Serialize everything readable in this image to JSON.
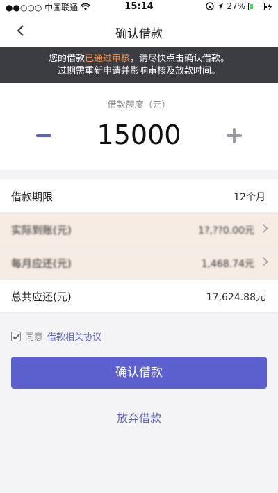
{
  "status_bar": {
    "carrier": "●●○○○ 中国联通",
    "time": "15:14",
    "battery": "27%",
    "battery_level": 0.27
  },
  "nav": {
    "title": "确认借款",
    "back_icon": "chevron-left-icon"
  },
  "notice": {
    "line1_prefix": "您的借款",
    "line1_highlight": "已通过审核",
    "line1_suffix": "，请尽快点击确认借款。",
    "line2": "过期需重新申请并影响审核及放款时间。"
  },
  "amount_card": {
    "label": "借款额度（元）",
    "amount": "15000",
    "minus_icon": "minus-icon",
    "plus_icon": "plus-icon"
  },
  "rows": [
    {
      "key": "借款期限",
      "value": "12个月"
    },
    {
      "key": "实际到账(元)",
      "value": "1?,??0.00元"
    },
    {
      "key": "每月应还(元)",
      "value": "1,468.74元"
    },
    {
      "key": "总共应还(元)",
      "value": "17,624.88元"
    }
  ],
  "agreement": {
    "text": "同意",
    "link": "借款相关协议",
    "checked": true
  },
  "buttons": {
    "confirm": "确认借款",
    "abandon": "放弃借款"
  },
  "colors": {
    "accent": "#5c60cf",
    "notice_bg": "#3c3c43",
    "highlight": "#f0904a"
  }
}
